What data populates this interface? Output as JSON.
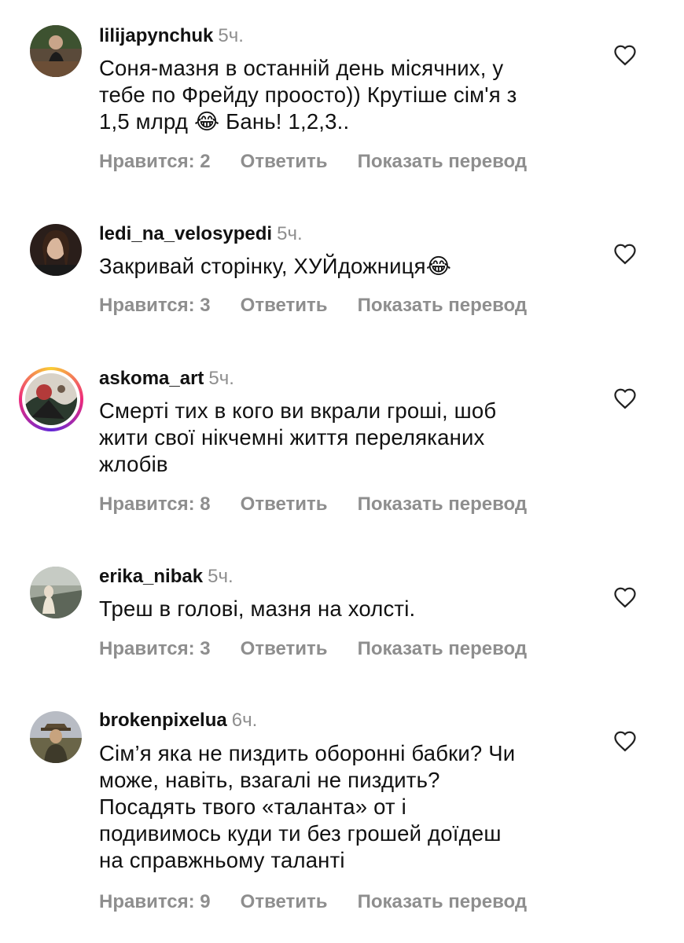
{
  "comments": [
    {
      "username": "lilijapynchuk",
      "time": "5ч.",
      "text_lines": [
        "Соня-мазня в останній день місячних, у",
        "тебе по Фрейду проосто)) Крутіше сім'я з",
        "1,5 млрд 😂 Бань! 1,2,3.."
      ],
      "likes": "Нравится: 2",
      "reply": "Ответить",
      "translate": "Показать перевод"
    },
    {
      "username": "ledi_na_velosypedi",
      "time": "5ч.",
      "text_lines": [
        "Закривай сторінку, ХУЙдожниця😂"
      ],
      "likes": "Нравится: 3",
      "reply": "Ответить",
      "translate": "Показать перевод"
    },
    {
      "username": "askoma_art",
      "time": "5ч.",
      "text_lines": [
        "Смерті тих в кого ви вкрали гроші, шоб",
        "жити свої нікчемні життя переляканих",
        "жлобів"
      ],
      "likes": "Нравится: 8",
      "reply": "Ответить",
      "translate": "Показать перевод"
    },
    {
      "username": "erika_nibak",
      "time": "5ч.",
      "text_lines": [
        "Треш в голові, мазня на холсті."
      ],
      "likes": "Нравится: 3",
      "reply": "Ответить",
      "translate": "Показать перевод"
    },
    {
      "username": "brokenpixelua",
      "time": "6ч.",
      "text_lines": [
        "Сім’я яка не пиздить оборонні бабки? Чи",
        "може, навіть, взагалі не пиздить?",
        "Посадять твого «таланта» от і",
        "подивимось куди ти без грошей доїдеш",
        "на справжньому таланті"
      ],
      "likes": "Нравится: 9",
      "reply": "Ответить",
      "translate": "Показать перевод"
    }
  ],
  "colors": {
    "text": "#111111",
    "muted": "#8e8e8e",
    "background": "#ffffff"
  }
}
